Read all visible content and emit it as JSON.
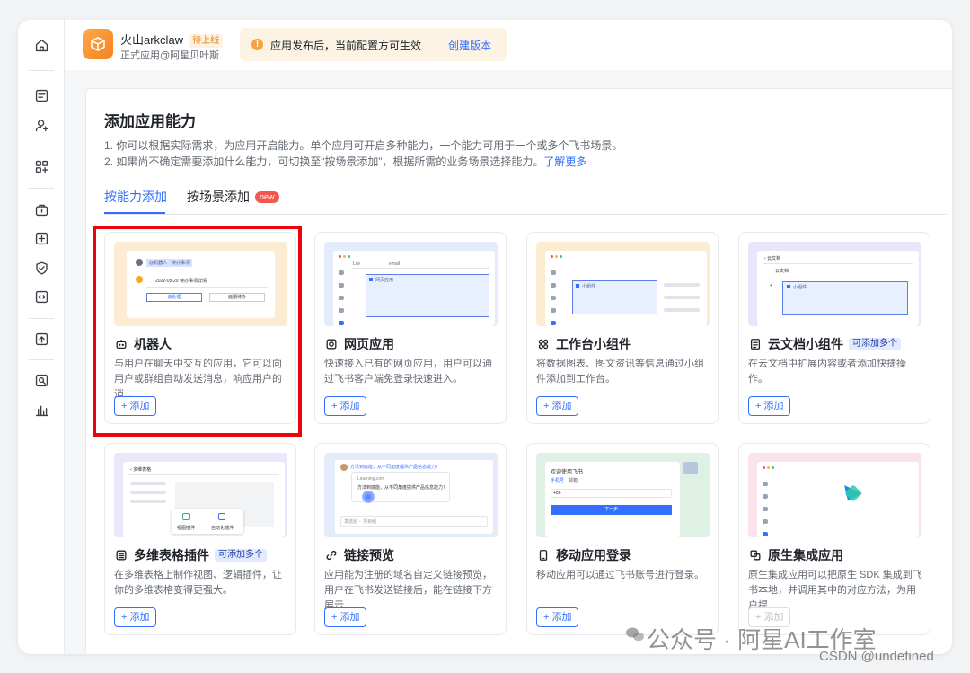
{
  "app": {
    "name": "火山arkclaw",
    "status_tag": "待上线",
    "subtitle": "正式应用@阿星贝叶斯"
  },
  "notice": {
    "text": "应用发布后，当前配置方可生效",
    "link": "创建版本",
    "icon": "warning-icon"
  },
  "sidebar_icons": [
    "home-icon",
    "document-icon",
    "add-user-icon",
    "apps-grid-icon",
    "toolbox-icon",
    "add-square-icon",
    "shield-check-icon",
    "code-icon",
    "upload-icon",
    "search-doc-icon",
    "chart-icon"
  ],
  "page": {
    "title": "添加应用能力",
    "desc1": "1. 你可以根据实际需求，为应用开启能力。单个应用可开启多种能力，一个能力可用于一个或多个飞书场景。",
    "desc2": "2. 如果尚不确定需要添加什么能力，可切换至“按场景添加”，根据所需的业务场景选择能力。",
    "learn_more": "了解更多"
  },
  "tabs": [
    {
      "label": "按能力添加",
      "active": true
    },
    {
      "label": "按场景添加",
      "badge": "new"
    }
  ],
  "cards": [
    {
      "title": "机器人",
      "icon": "robot-icon",
      "desc": "与用户在聊天中交互的应用，它可以向用户或群组自动发送消息，响应用户的消…",
      "button": "+ 添加",
      "preview_color": "#fbecd2"
    },
    {
      "title": "网页应用",
      "icon": "web-icon",
      "desc": "快速接入已有的网页应用，用户可以通过飞书客户端免登录快速进入。",
      "button": "+ 添加",
      "preview_color": "#e4ebfb"
    },
    {
      "title": "工作台小组件",
      "icon": "widget-icon",
      "desc": "将数据图表、图文资讯等信息通过小组件添加到工作台。",
      "button": "+ 添加",
      "preview_color": "#fbecd2"
    },
    {
      "title": "云文档小组件",
      "icon": "cloud-doc-icon",
      "badge": "可添加多个",
      "desc": "在云文档中扩展内容或者添加快捷操作。",
      "button": "+ 添加",
      "preview_color": "#e7e6fa"
    },
    {
      "title": "多维表格插件",
      "icon": "table-icon",
      "badge": "可添加多个",
      "desc": "在多维表格上制作视图、逻辑插件，让你的多维表格变得更强大。",
      "button": "+ 添加",
      "preview_color": "#ece6fb"
    },
    {
      "title": "链接预览",
      "icon": "link-icon",
      "desc": "应用能为注册的域名自定义链接预览，用户在飞书发送链接后，能在链接下方展示…",
      "button": "+ 添加",
      "preview_color": "#e4ebfb"
    },
    {
      "title": "移动应用登录",
      "icon": "mobile-icon",
      "desc": "移动应用可以通过飞书账号进行登录。",
      "button": "+ 添加",
      "preview_color": "#dff1e4"
    },
    {
      "title": "原生集成应用",
      "icon": "native-app-icon",
      "desc": "原生集成应用可以把原生 SDK 集成到飞书本地，并调用其中的对应方法，为用户提…",
      "button": "+ 添加",
      "disabled": true,
      "preview_color": "#fbe3ec"
    }
  ],
  "previews": {
    "robot": {
      "tag": "@机器人",
      "todo": "待办事项",
      "date_text": "2022-05-20 待办事项详情",
      "btn1": "去处理",
      "btn2": "延期待办"
    },
    "web": {
      "tab1": "Lite",
      "tab2": "email",
      "box": "网页应用"
    },
    "widget": {
      "box": "小组件"
    },
    "clouddoc": {
      "back": "云文档",
      "title": "云文档",
      "box": "小组件"
    },
    "bitable": {
      "back": "多维表格",
      "item1": "视图插件",
      "item2": "自动化插件"
    },
    "link": {
      "msg": "方法到底能，从不同角度提供产品信息能力！",
      "url": "Learning.com",
      "card": "方法到底能，从不同角度提供产品信息能力！",
      "input": "发送给 ·· 项目组"
    },
    "mobile": {
      "welcome": "欢迎使用飞书",
      "t1": "手机号",
      "t2": "邮箱",
      "prefix": "+86",
      "next": "下一步"
    }
  },
  "watermark": {
    "main": "公众号 · 阿星AI工作室",
    "footer": "CSDN @undefined"
  },
  "colors": {
    "accent": "#3370ff",
    "highlight": "#e8050b",
    "app_orange": "#f5821f"
  }
}
